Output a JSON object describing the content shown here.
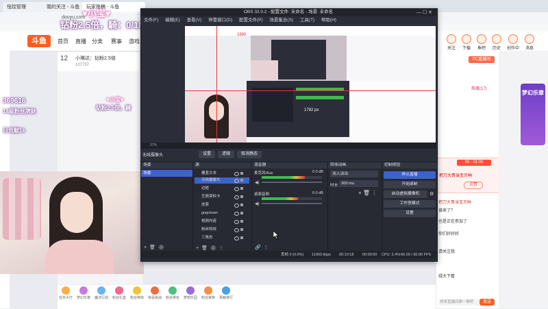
{
  "browser": {
    "tabs": [
      "恒控管理",
      "我的关注 - 斗鱼",
      "玩家拖稿 - 斗鱼"
    ],
    "url": "douyu.com"
  },
  "site": {
    "logo": "斗鱼",
    "nav": [
      "首页",
      "直播",
      "分类",
      "赛事",
      "游戏"
    ],
    "right_nav": [
      "关注",
      "下载",
      "鱼吧",
      "历史",
      "创作中心",
      "消息"
    ],
    "stream_title": "小琳达：钻粉2.5倍",
    "stream_count": "12",
    "stream_id": "107737",
    "hot": "热度(17)"
  },
  "overlays": {
    "top_name": "♥小宝♥",
    "top_banner": "钻粉2.5倍，騎：0/1890",
    "left_count": "369616",
    "left_line1": "14级粉丝牌鈥",
    "left_line2": "日贡献1k",
    "mini_name": "♥小宝♥",
    "mini_banner": "钻粉2.5倍，騎"
  },
  "obs": {
    "title": "OBS 32.0.2 - 配置文件: 未命名 - 场景: 未命名",
    "menu": [
      "文件(F)",
      "编辑(E)",
      "查看(V)",
      "停靠窗口(D)",
      "配置文件(P)",
      "场景集合(S)",
      "工具(T)",
      "帮助(H)"
    ],
    "zoom_label": "37%",
    "preview_size_label": "1792 px",
    "preview_top_label": "1890",
    "ctrl_buttons": [
      "设置",
      "滤镜",
      "取消静态"
    ],
    "selected_source": "无线摄像头",
    "docks": {
      "scenes": "场景",
      "sources": "源",
      "mixer": "混音器",
      "transitions": "转场动画",
      "controls": "控制按钮"
    },
    "scenes": [
      "场景"
    ],
    "sources": [
      "覆盖文本",
      "无线摄像头",
      "边框",
      "互侧资料卡",
      "皮套",
      "gogotown",
      "视频内容",
      "粉丝特效",
      "三角形"
    ],
    "mixer": [
      {
        "name": "麦克风/Aux",
        "db": "0.0 dB",
        "level": 0.72
      },
      {
        "name": "桌面音频",
        "db": "0.0 dB",
        "level": 0.6
      }
    ],
    "transition": {
      "type": "淡入淡出",
      "duration_label": "时长",
      "duration": "300 ms"
    },
    "controls": [
      "停止直播",
      "开始录制",
      "启动虚拟摄像机",
      "工作室模式",
      "设置"
    ],
    "status": {
      "frames": "丢帧 0 (0.0%)",
      "bitrate": "11993 kbps",
      "time1": "00:10:18",
      "time2": "00:00:00",
      "cpu": "CPU: 2.4%",
      "fps": "60.00 / 60.00 FPS"
    }
  },
  "chat": {
    "badge": "PC直播间",
    "timer": "00 : 01:00",
    "lines": [
      "把刀大哥当宝贝呐",
      "点赞",
      "把刀大哥当宝贝呐",
      "谁来了？",
      "也是正在参加了",
      "你们好好好",
      "请关注我",
      "绿大下看"
    ],
    "input_placeholder": "快来直播间聊一聊吧",
    "send": "发送"
  },
  "side_banner": "梦幻乐章",
  "gifts": [
    "任务大厅",
    "梦幻乐章",
    "魔法行动",
    "粉丝礼盒",
    "粉丝特效",
    "惊喜挑战",
    "粉丝排名",
    "梦想乐园",
    "粉丝家族",
    "贡献排行"
  ],
  "colors": {
    "brand": "#ff5d23",
    "obs_bg": "#2b2e38",
    "obs_blue": "#3d63c9"
  }
}
